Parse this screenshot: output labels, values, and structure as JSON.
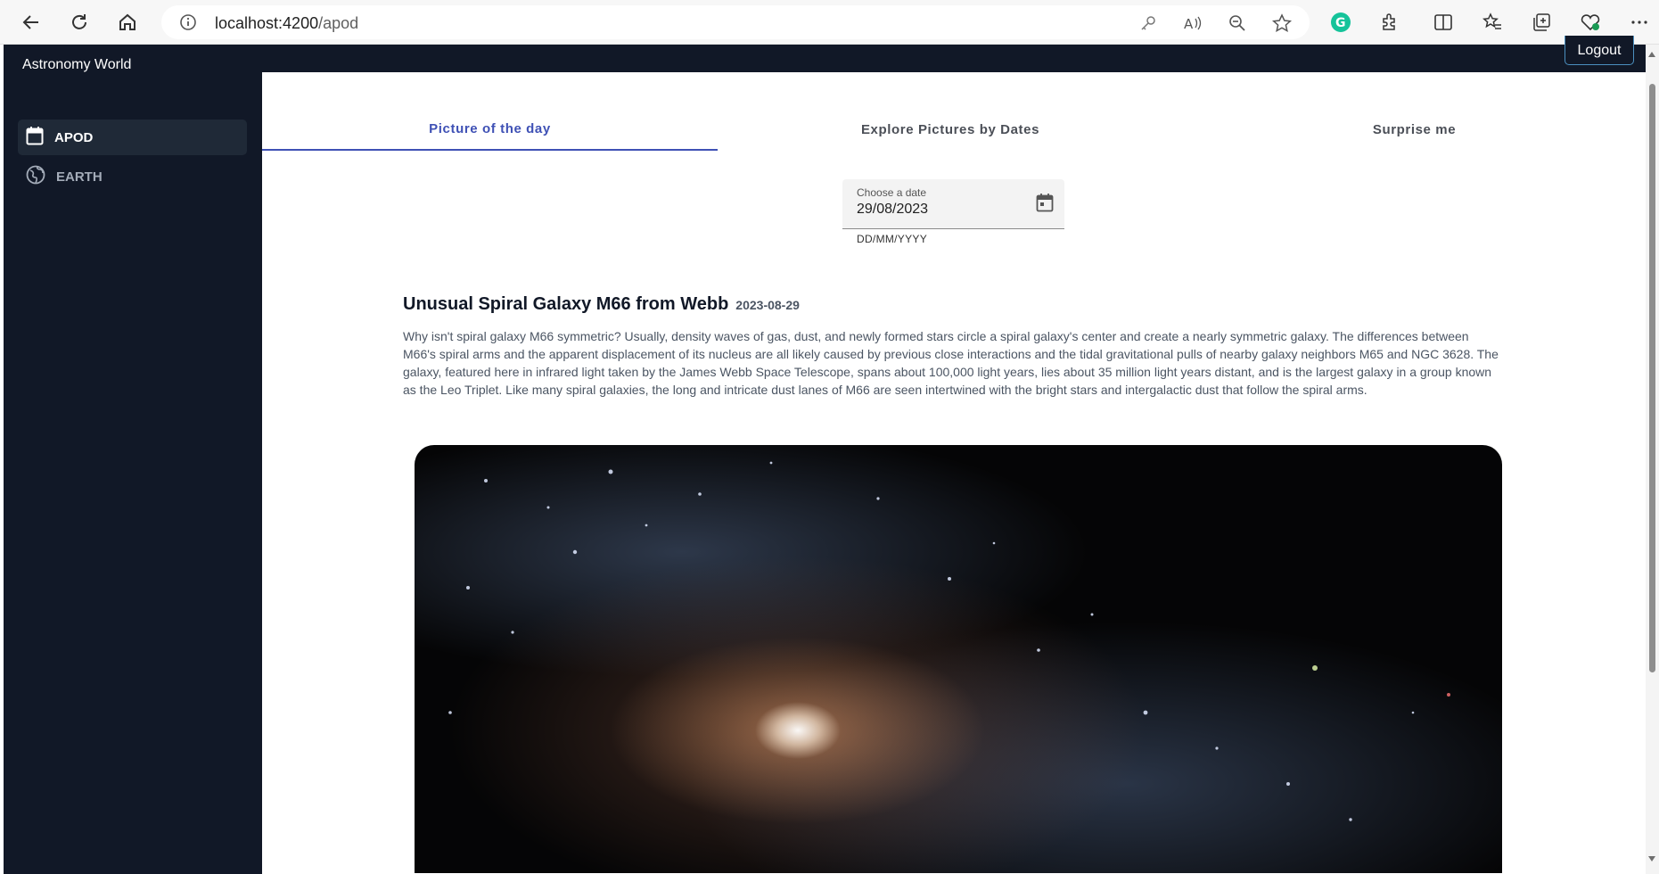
{
  "browser": {
    "url_host": "localhost:4200",
    "url_path": "/apod"
  },
  "app": {
    "title": "Astronomy World",
    "logout_label": "Logout"
  },
  "sidebar": {
    "items": [
      {
        "label": "APOD",
        "icon": "calendar-icon",
        "active": true
      },
      {
        "label": "EARTH",
        "icon": "globe-icon",
        "active": false
      }
    ]
  },
  "tabs": [
    {
      "label": "Picture of the day",
      "active": true
    },
    {
      "label": "Explore Pictures by Dates",
      "active": false
    },
    {
      "label": "Surprise me",
      "active": false
    }
  ],
  "date_picker": {
    "label": "Choose a date",
    "value": "29/08/2023",
    "hint": "DD/MM/YYYY"
  },
  "apod": {
    "title": "Unusual Spiral Galaxy M66 from Webb",
    "date": "2023-08-29",
    "description": "Why isn't spiral galaxy M66 symmetric? Usually, density waves of gas, dust, and newly formed stars circle a spiral galaxy's center and create a nearly symmetric galaxy. The differences between M66's spiral arms and the apparent displacement of its nucleus are all likely caused by previous close interactions and the tidal gravitational pulls of nearby galaxy neighbors M65 and NGC 3628. The galaxy, featured here in infrared light taken by the James Webb Space Telescope, spans about 100,000 light years, lies about 35 million light years distant, and is the largest galaxy in a group known as the Leo Triplet. Like many spiral galaxies, the long and intricate dust lanes of M66 are seen intertwined with the bright stars and intergalactic dust that follow the spiral arms."
  },
  "colors": {
    "sidebar_bg": "#111827",
    "active_tab": "#3f51b5"
  }
}
